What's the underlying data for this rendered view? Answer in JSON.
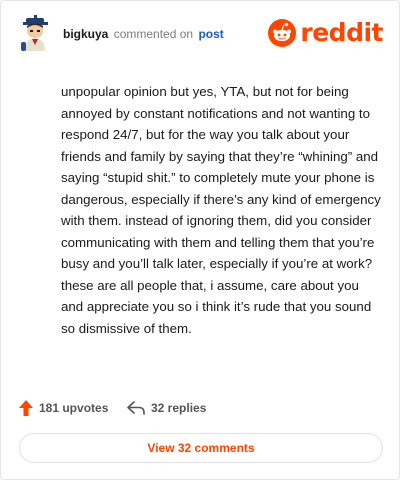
{
  "header": {
    "username": "bigkuya",
    "action_text": "commented on",
    "post_link_label": "post",
    "brand_name": "reddit"
  },
  "comment": {
    "body": "unpopular opinion but yes, YTA, but not for being annoyed by constant notifications and not wanting to respond 24/7, but for the way you talk about your friends and family by saying that they’re “whining” and saying “stupid shit.” to completely mute your phone is dangerous, especially if there’s any kind of emergency with them. instead of ignoring them, did you consider communicating with them and telling them that you’re busy and you’ll talk later, especially if you’re at work? these are all people that, i assume, care about you and appreciate you so i think it’s rude that you sound so dismissive of them."
  },
  "footer": {
    "upvotes_label": "181 upvotes",
    "replies_label": "32 replies",
    "view_comments_label": "View 32 comments"
  },
  "icons": {
    "upvote": "upvote-arrow-icon",
    "reply": "reply-arrow-icon",
    "brand": "reddit-snoo-icon",
    "avatar": "user-avatar"
  },
  "colors": {
    "accent": "#ff4500",
    "link": "#1a5dbe",
    "muted": "#7c7c7c"
  }
}
